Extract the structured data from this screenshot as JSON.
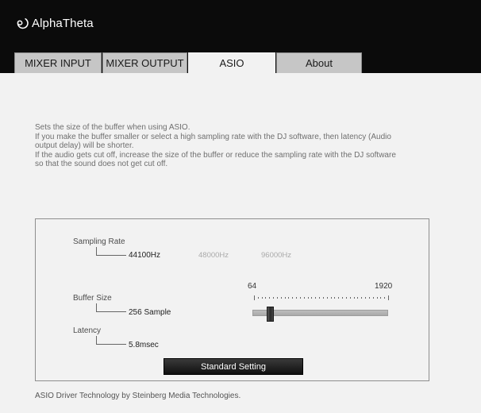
{
  "app": {
    "brand": "AlphaTheta",
    "logo_icon": "alphatheta-swirl-icon"
  },
  "tabs": [
    {
      "label": "MIXER INPUT",
      "active": false
    },
    {
      "label": "MIXER OUTPUT",
      "active": false
    },
    {
      "label": "ASIO",
      "active": true
    },
    {
      "label": "About",
      "active": false
    }
  ],
  "description": [
    "Sets the size of the buffer when using ASIO.",
    "If you make the buffer smaller or select a high sampling rate with the DJ software, then latency (Audio",
    "output delay) will be shorter.",
    "If the audio gets cut off, increase the size of the buffer or reduce the sampling rate with the DJ software",
    "so that the sound does not get cut off."
  ],
  "sampling_rate": {
    "label": "Sampling Rate",
    "options": [
      "44100Hz",
      "48000Hz",
      "96000Hz"
    ],
    "selected": "44100Hz"
  },
  "buffer_size": {
    "label": "Buffer Size",
    "value": "256 Sample",
    "min_label": "64",
    "max_label": "1920",
    "slider_fraction": 0.11
  },
  "latency": {
    "label": "Latency",
    "value": "5.8msec"
  },
  "standard_button": "Standard Setting",
  "footer": "ASIO Driver Technology by Steinberg Media Technologies.",
  "colors": {
    "titlebar": "#0b0b0b",
    "tab_inactive": "#c6c6c6",
    "content_bg": "#f2f2f2",
    "button": "#1a1a1a"
  }
}
